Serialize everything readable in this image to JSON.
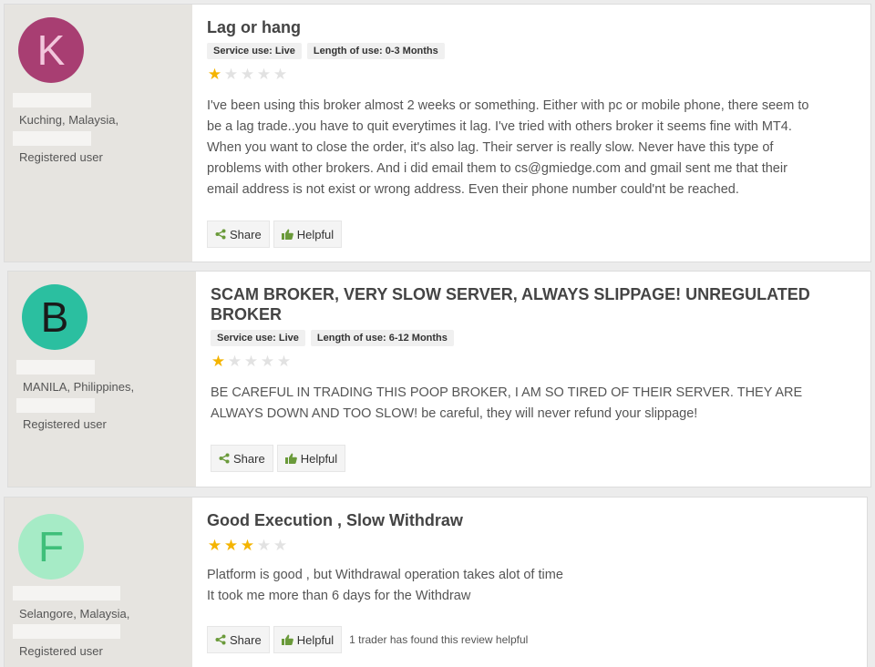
{
  "icons": {
    "share": "share-icon",
    "helpful": "thumbs-up-icon",
    "star": "star-icon"
  },
  "colors": {
    "star_on": "#f4b400",
    "star_off": "#e2e2e2",
    "icon_green": "#6a9a3a"
  },
  "reviews": [
    {
      "avatar": {
        "letter": "K",
        "bg": "#a83e72",
        "fg": "#f2c7dc"
      },
      "location": "Kuching, Malaysia,",
      "status": "Registered user",
      "title": "Lag or hang",
      "tags": [
        "Service use: Live",
        "Length of use: 0-3 Months"
      ],
      "rating": 1,
      "lines": [
        "I've been using this broker almost 2 weeks or something. Either with pc or mobile phone, there seem to",
        "be a lag trade..you have to quit everytimes it lag. I've tried with others broker it seems fine with MT4.",
        "When you want to close the order, it's also lag. Their server is really slow. Never have this type of",
        "problems with other brokers. And i did email them to cs@gmiedge.com and gmail sent me that their",
        "email address is not exist or wrong address. Even their phone number could'nt be reached."
      ],
      "share_label": "Share",
      "helpful_label": "Helpful",
      "helpful_note": ""
    },
    {
      "avatar": {
        "letter": "B",
        "bg": "#2bbfa0",
        "fg": "#1a1a1a"
      },
      "location": "MANILA, Philippines,",
      "status": "Registered user",
      "title_lines": [
        "SCAM BROKER, VERY SLOW SERVER, ALWAYS SLIPPAGE! UNREGULATED",
        "BROKER"
      ],
      "tags": [
        "Service use: Live",
        "Length of use: 6-12 Months"
      ],
      "rating": 1,
      "lines": [
        "BE CAREFUL IN TRADING THIS POOP BROKER, I AM SO TIRED OF THEIR SERVER. THEY ARE",
        "ALWAYS DOWN AND TOO SLOW! be careful, they will never refund your slippage!"
      ],
      "share_label": "Share",
      "helpful_label": "Helpful",
      "helpful_note": ""
    },
    {
      "avatar": {
        "letter": "F",
        "bg": "#a6ebc6",
        "fg": "#3fbf7a"
      },
      "location": "Selangore, Malaysia,",
      "status": "Registered user",
      "title": "Good Execution , Slow Withdraw",
      "rating": 3,
      "lines": [
        "Platform is good , but Withdrawal operation takes alot of time",
        "It took me more than 6 days for the Withdraw"
      ],
      "share_label": "Share",
      "helpful_label": "Helpful",
      "helpful_note": "1 trader has found this review helpful"
    }
  ]
}
